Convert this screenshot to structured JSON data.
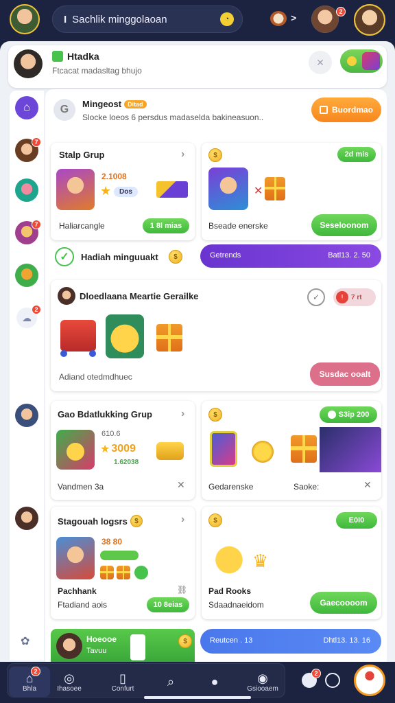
{
  "top_bar": {
    "search_text": "Sachlik minggolaoan",
    "search_cursor": "I",
    "mic_icon": "mic-icon",
    "next_arrow": ">",
    "badge_count": "2"
  },
  "notification": {
    "title": "Htadka",
    "subtitle": "Ftcacat madasltag bhujo"
  },
  "promo": {
    "title": "Mingeost",
    "tag": "Ditad",
    "subtitle": "Slocke loeos 6 persdus madaselda bakineasuon..",
    "button": "Buordmao"
  },
  "cards": {
    "shop_group": {
      "title": "Stalp Grup",
      "price": "2.1008",
      "price_tag": "Dos",
      "label": "Haliarcangle",
      "button": "1 8l mias"
    },
    "bonus": {
      "pill": "2d mis",
      "label": "Bseade enerske",
      "button": "Seseloonom"
    },
    "reward_row": {
      "title": "Hadiah minguuakt",
      "purple_left": "Getrends",
      "purple_right": "Batl13. 2. 50"
    },
    "daily": {
      "title": "Dloedlaana Meartie Gerailke",
      "red_pill": "7 rt",
      "label": "Adiand otedmdhuec",
      "button": "Susdac ooalt"
    },
    "shaking": {
      "title": "Gao Bdatlukking Grup",
      "small": "610.6",
      "stars": "3009",
      "sub_value": "1.62038",
      "label": "Vandmen 3a",
      "badge": "S3ip 200",
      "right_label_1": "Gedarenske",
      "right_label_2": "Saoke:"
    },
    "logsrs": {
      "title": "Stagouah logsrs",
      "amount": "38 80",
      "label1": "Pachhank",
      "label2": "Ftadiand aois",
      "button": "10 8eias",
      "pill": "E0I0",
      "right_label1": "Pad Rooks",
      "right_label2": "Sdaadnaeidom",
      "right_button": "Gaecoooom"
    },
    "bottom_green": {
      "title": "Hoeooe",
      "sub": "Tavuu"
    },
    "bottom_blue": {
      "left": "Reutcen . 13",
      "right": "Dhtl13. 13. 16"
    }
  },
  "nav": {
    "items": [
      {
        "label": "Bhla",
        "icon": "home-icon"
      },
      {
        "label": "Ihasoee",
        "icon": "compass-icon"
      },
      {
        "label": "Confurt",
        "icon": "book-icon"
      },
      {
        "label": "",
        "icon": "search-icon"
      },
      {
        "label": "",
        "icon": "chat-icon"
      },
      {
        "label": "Gsiooaem",
        "icon": "settings-icon"
      }
    ],
    "badge": "2"
  },
  "colors": {
    "navy": "#1c2340",
    "green": "#47c24c",
    "orange": "#f7941d",
    "purple": "#7b3fd6",
    "blue": "#4d7ef0",
    "pink": "#dc6f8a"
  }
}
